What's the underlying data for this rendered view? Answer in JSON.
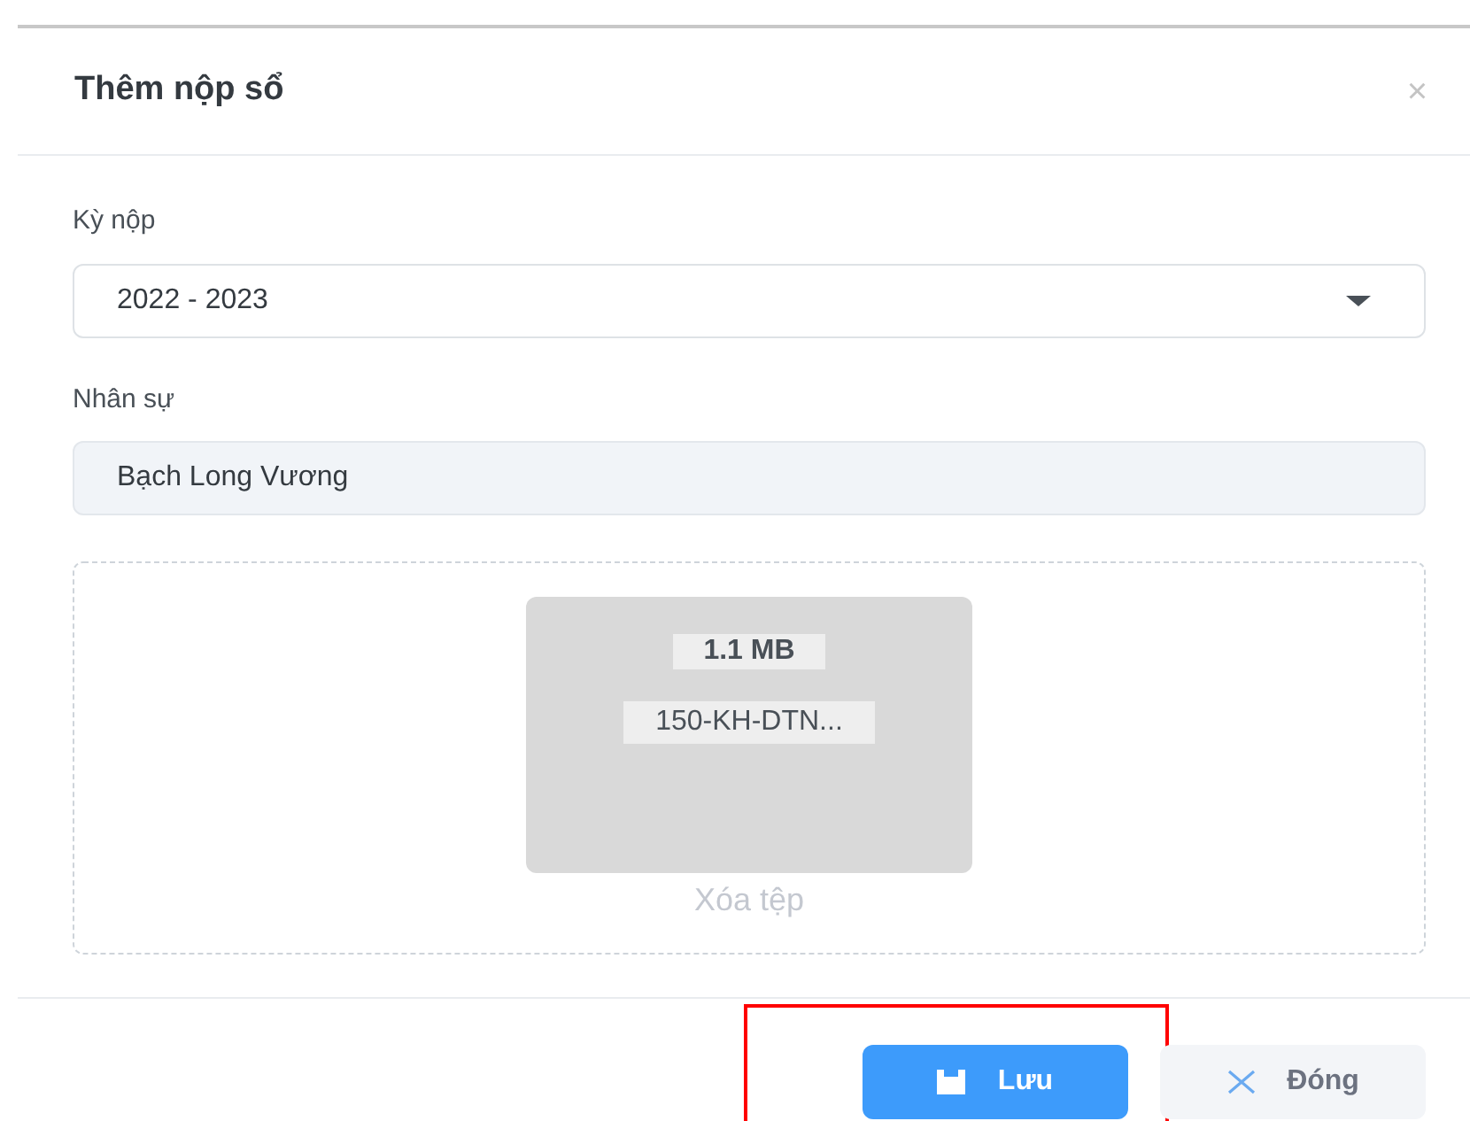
{
  "dialog": {
    "title": "Thêm nộp sổ",
    "close": "×"
  },
  "fields": [
    {
      "kind": "select",
      "label": "Kỳ nộp",
      "value": "2022 - 2023"
    },
    {
      "kind": "readonly",
      "label": "Nhân sự",
      "value": "Bạch Long Vương"
    }
  ],
  "upload": {
    "file_size": "1.1 MB",
    "file_name": "150-KH-DTN...",
    "remove": "Xóa tệp"
  },
  "buttons": [
    {
      "kind": "save",
      "label": "Lưu",
      "highlighted": true
    },
    {
      "kind": "close",
      "label": "Đóng",
      "highlighted": false
    }
  ]
}
